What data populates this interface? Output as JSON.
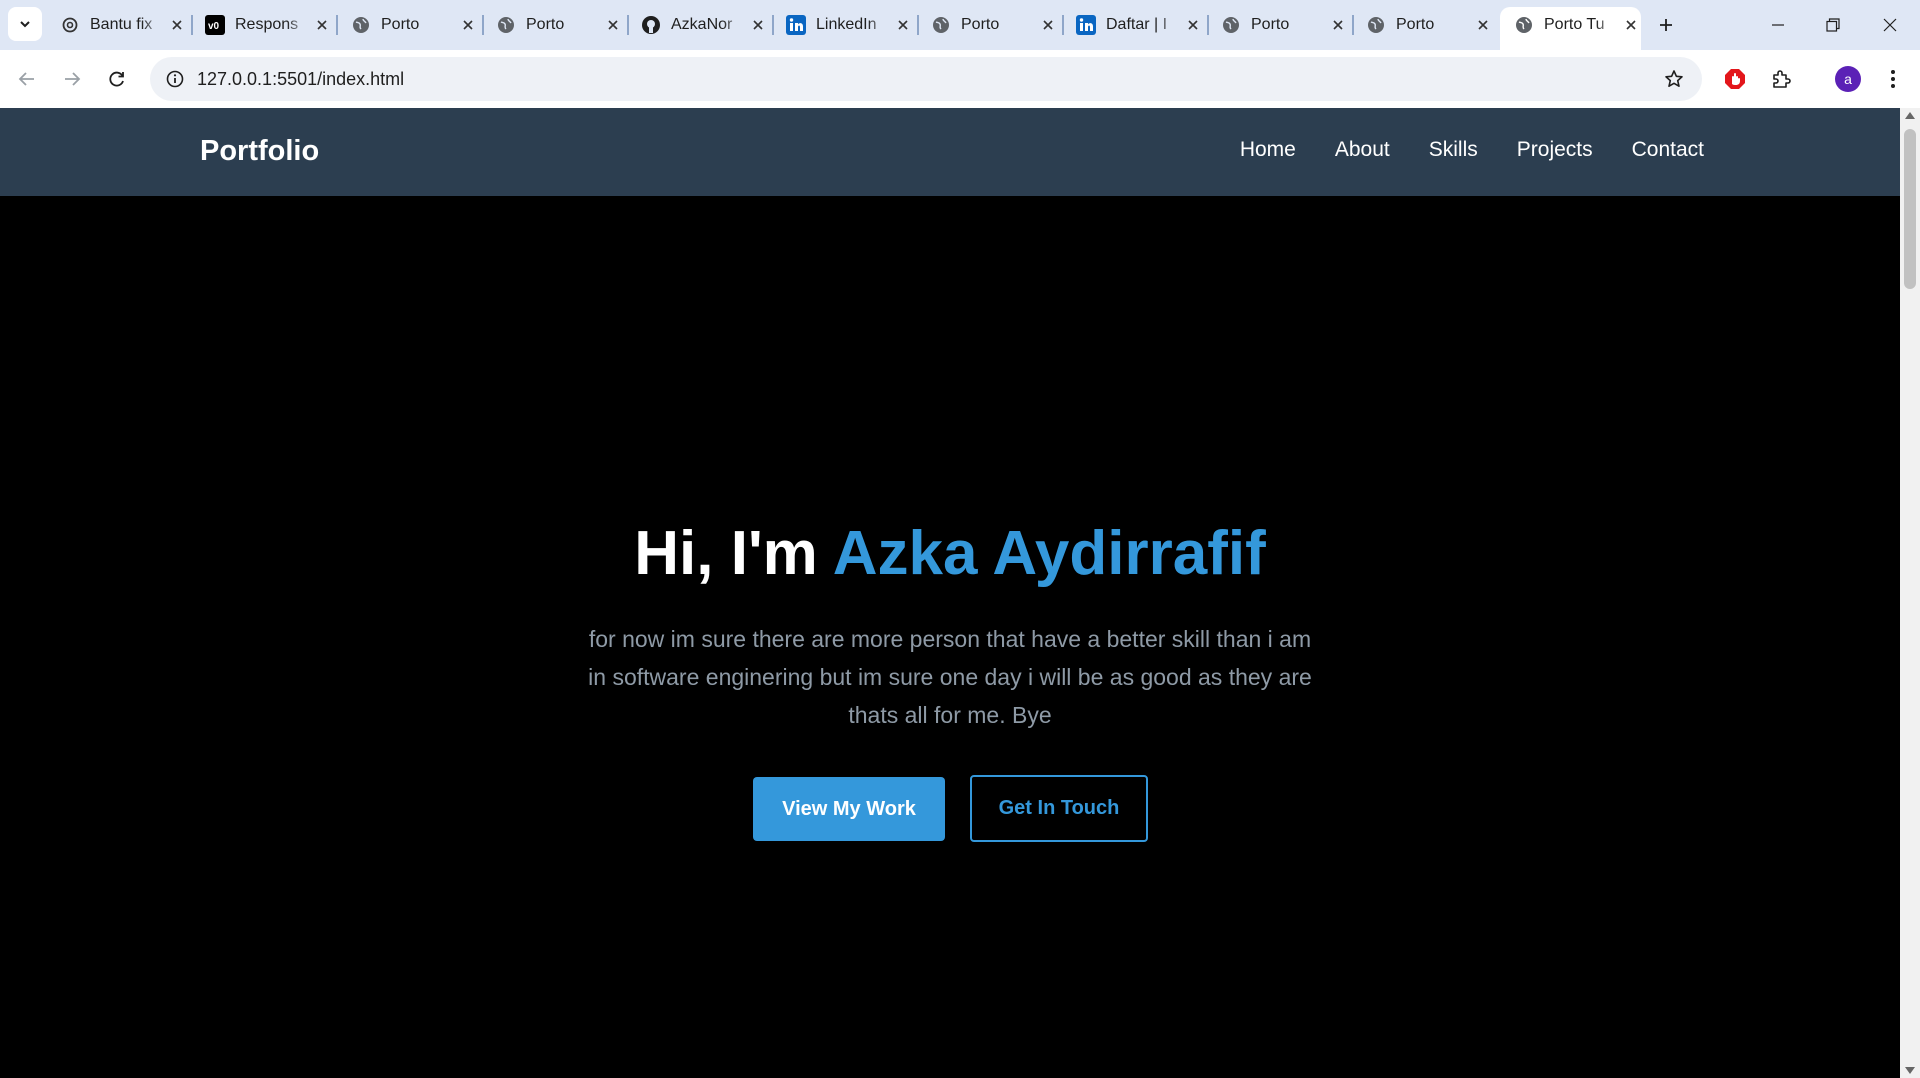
{
  "browser": {
    "tabs": [
      {
        "title": "Bantu fix",
        "icon": "openai-icon"
      },
      {
        "title": "Respons",
        "icon": "v0-icon"
      },
      {
        "title": "Porto",
        "icon": "globe-icon"
      },
      {
        "title": "Porto",
        "icon": "globe-icon"
      },
      {
        "title": "AzkaNor",
        "icon": "github-icon"
      },
      {
        "title": "LinkedIn",
        "icon": "linkedin-icon"
      },
      {
        "title": "Porto",
        "icon": "globe-icon"
      },
      {
        "title": "Daftar | I",
        "icon": "linkedin-icon"
      },
      {
        "title": "Porto",
        "icon": "globe-icon"
      },
      {
        "title": "Porto",
        "icon": "globe-icon"
      },
      {
        "title": "Porto Tu",
        "icon": "globe-icon",
        "active": true
      }
    ],
    "url": "127.0.0.1:5501/index.html",
    "profile_initial": "a"
  },
  "site": {
    "logo": "Portfolio",
    "nav": [
      "Home",
      "About",
      "Skills",
      "Projects",
      "Contact"
    ],
    "hero": {
      "greeting": "Hi, I'm ",
      "name": "Azka Aydirrafif",
      "subtitle": "for now im sure there are more person that have a better skill than i am in software enginering but im sure one day i will be as good as they are thats all for me. Bye",
      "primary_button": "View My Work",
      "secondary_button": "Get In Touch"
    }
  },
  "colors": {
    "nav_bg": "#2c3e50",
    "accent": "#3498db",
    "hero_bg": "#000000",
    "subtitle_text": "#8e9aa6"
  }
}
